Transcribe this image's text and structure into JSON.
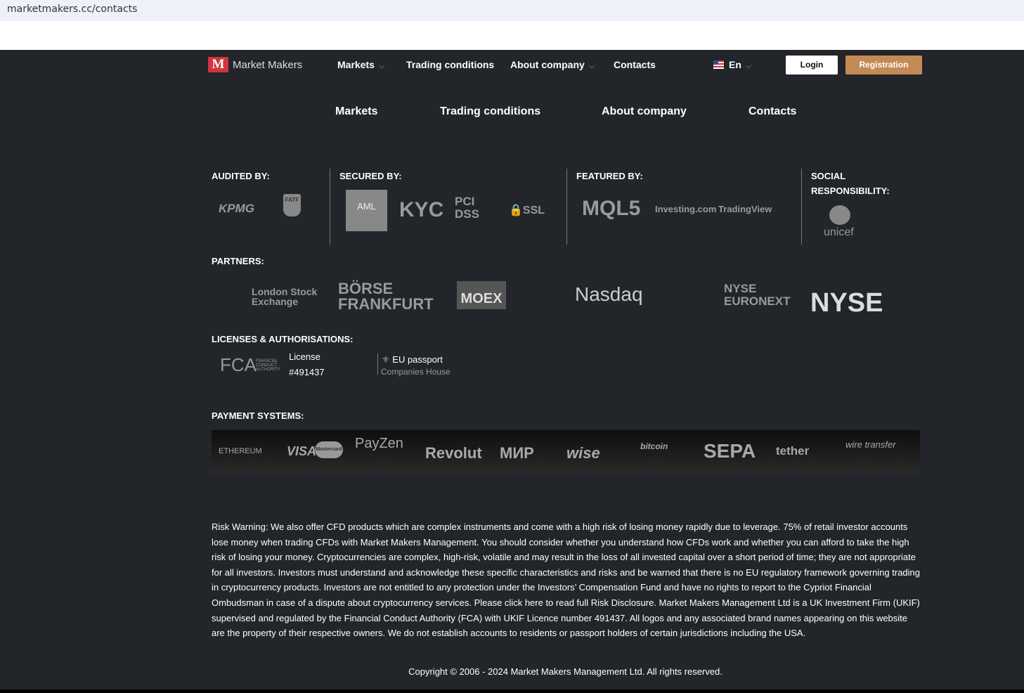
{
  "browser": {
    "url": "marketmakers.cc/contacts"
  },
  "header": {
    "brand_mark": "M",
    "brand": "Market Makers",
    "nav": [
      "Markets",
      "Trading conditions",
      "About company",
      "Contacts"
    ],
    "lang": "En",
    "login": "Login",
    "register": "Registration"
  },
  "footer_nav": [
    "Markets",
    "Trading conditions",
    "About company",
    "Contacts"
  ],
  "sections": {
    "audited": "AUDITED BY:",
    "secured": "SECURED BY:",
    "featured": "FEATURED BY:",
    "social1": "SOCIAL",
    "social2": "RESPONSIBILITY:",
    "partners": "PARTNERS:",
    "licenses": "LICENSES & AUTHORISATIONS:",
    "payments": "PAYMENT SYSTEMS:"
  },
  "logos": {
    "audited": [
      "KPMG",
      "FATF"
    ],
    "secured": [
      "AML",
      "KYC",
      "PCI DSS",
      "SSL"
    ],
    "featured": [
      "MQL5",
      "Investing.com",
      "TradingView"
    ],
    "social": [
      "unicef"
    ],
    "partners": [
      "London Stock Exchange",
      "BÖRSE FRANKFURT",
      "MOEX",
      "Nasdaq",
      "NYSE EURONEXT",
      "NYSE"
    ],
    "payments": [
      "ETHEREUM",
      "VISA",
      "Mastercard",
      "PayZen",
      "Revolut",
      "МИР",
      "wise",
      "bitcoin",
      "SEPA",
      "tether",
      "wire transfer"
    ]
  },
  "licenses": {
    "fca": "FCA",
    "fca_sub": "FINANCIAL CONDUCT AUTHORITY",
    "license_label": "License",
    "license_no": "#491437",
    "eu": "EU passport",
    "eu_sub": "Companies House"
  },
  "risk": "Risk Warning: We also offer CFD products which are complex instruments and come with a high risk of losing money rapidly due to leverage. 75% of retail investor accounts lose money when trading CFDs with Market Makers Management. You should consider whether you understand how CFDs work and whether you can afford to take the high risk of losing your money. Cryptocurrencies are complex, high-risk, volatile and may result in the loss of all invested capital over a short period of time; they are not appropriate for all investors. Investors must understand and acknowledge these specific characteristics and risks and be warned that there is no EU regulatory framework governing trading in cryptocurrency products. Investors are not entitled to any protection under the Investors’  Compensation Fund and have no rights to report to the Cypriot Financial Ombudsman in case of a dispute about cryptocurrency services. Please click here to read full Risk Disclosure. Market Makers Management Ltd is a UK Investment Firm (UKIF) supervised and regulated by the Financial Conduct Authority (FCA) with UKIF Licence number 491437. All logos and any associated brand names appearing on this website are the property of their respective owners. We do not establish accounts to residents or passport holders of certain jurisdictions including the USA.",
  "copyright": "Copyright © 2006 - 2024 Market Makers Management Ltd. All rights reserved."
}
